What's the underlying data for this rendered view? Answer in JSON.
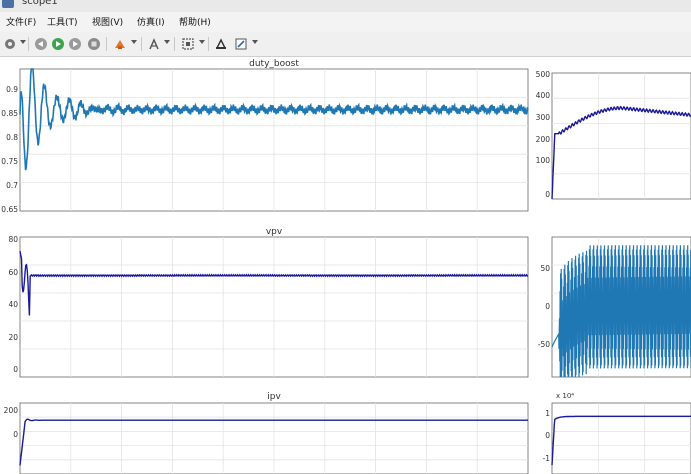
{
  "window": {
    "title": "scope1"
  },
  "menu": [
    "文件(F)",
    "工具(T)",
    "视图(V)",
    "仿真(I)",
    "帮助(H)"
  ],
  "toolbar": {
    "icons": [
      "settings-icon",
      "step-back-icon",
      "run-icon",
      "step-forward-icon",
      "stop-icon",
      "highlight-icon",
      "signal-icon",
      "zoom-fit-icon",
      "autoscale-icon",
      "style-icon"
    ]
  },
  "plots": {
    "duty": {
      "title": "duty_boost",
      "yticks": [
        "0.9",
        "0.85",
        "0.8",
        "0.75",
        "0.7",
        "0.65"
      ],
      "ylim": [
        0.65,
        0.93
      ],
      "steady": 0.85,
      "color": "#1f77b4"
    },
    "vpv": {
      "title": "vpv",
      "yticks": [
        "80",
        "60",
        "40",
        "20",
        "0"
      ],
      "ylim": [
        0,
        80
      ],
      "steady": 58,
      "color": "#1a1a9a"
    },
    "ipv": {
      "title": "ipv",
      "yticks": [
        "200",
        "0"
      ],
      "ylim": [
        -100,
        230
      ],
      "steady": 150,
      "color": "#1a1a9a"
    },
    "right_top": {
      "yticks": [
        "500",
        "400",
        "300",
        "200",
        "100",
        "0"
      ],
      "ylim": [
        0,
        540
      ],
      "steady": 360,
      "color": "#1a1a9a"
    },
    "right_mid": {
      "yticks": [
        "50",
        "0",
        "-50"
      ],
      "ylim": [
        -70,
        70
      ],
      "color": "#1f77b4"
    },
    "right_bot": {
      "exponent": "x 10⁴",
      "yticks": [
        "1",
        "0",
        "-1"
      ],
      "ylim": [
        -1.6,
        1.6
      ],
      "steady": 1.0,
      "color": "#1a1a9a"
    }
  }
}
